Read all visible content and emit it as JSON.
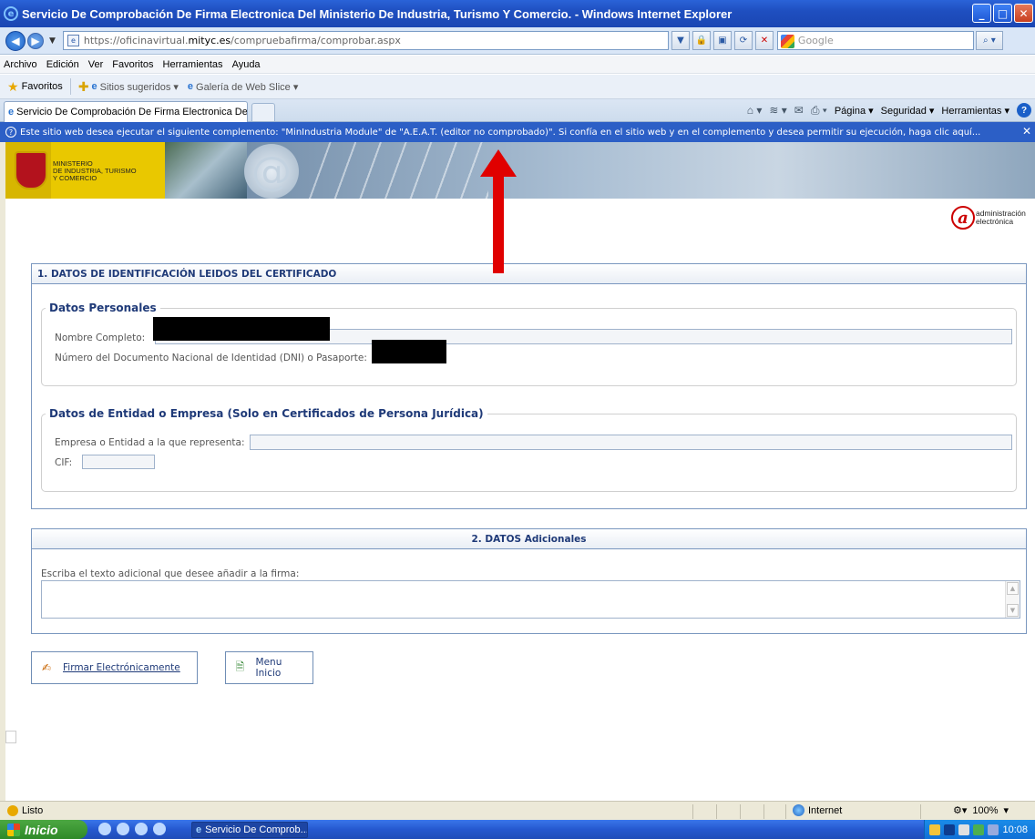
{
  "window": {
    "title": "Servicio De Comprobación De Firma Electronica Del Ministerio De Industria, Turismo Y Comercio. - Windows Internet Explorer",
    "controls": [
      "_",
      "□",
      "✕"
    ]
  },
  "address_bar": {
    "url_scheme_host": "https://oficinavirtual.",
    "url_domain": "mityc.es",
    "url_path": "/compruebafirma/comprobar.aspx",
    "search_placeholder": "Google"
  },
  "menu": [
    "Archivo",
    "Edición",
    "Ver",
    "Favoritos",
    "Herramientas",
    "Ayuda"
  ],
  "favorites_bar": {
    "label": "Favoritos",
    "items": [
      "Sitios sugeridos ▾",
      "Galería de Web Slice ▾"
    ]
  },
  "tab": {
    "label": "Servicio De Comprobación De Firma Electronica Del Mi..."
  },
  "command_bar": [
    "Página ▾",
    "Seguridad ▾",
    "Herramientas ▾"
  ],
  "info_bar": {
    "text": "Este sitio web desea ejecutar el siguiente complemento: \"MinIndustria Module\" de \"A.E.A.T. (editor no comprobado)\". Si confía en el sitio web y en el complemento y desea permitir su ejecución, haga clic aquí..."
  },
  "banner": {
    "ministry_line1": "MINISTERIO",
    "ministry_line2": "DE INDUSTRIA, TURISMO",
    "ministry_line3": "Y COMERCIO"
  },
  "ae_logo": {
    "letter": "a",
    "line1": "administración",
    "line2": "electrónica"
  },
  "section1": {
    "title": "1. DATOS DE IDENTIFICACIÓN LEIDOS DEL CERTIFICADO",
    "personal": {
      "legend": "Datos Personales",
      "name_label": "Nombre Completo:",
      "dni_label": "Número del Documento Nacional de Identidad (DNI) o Pasaporte:"
    },
    "company": {
      "legend": "Datos de Entidad o Empresa (Solo en Certificados de Persona Jurídica)",
      "company_label": "Empresa o Entidad a la que representa:",
      "cif_label": "CIF:"
    }
  },
  "section2": {
    "title": "2. DATOS Adicionales",
    "text_label": "Escriba el texto adicional que desee añadir a la firma:"
  },
  "buttons": {
    "sign": "Firmar Electrónicamente",
    "menu": "Menu Inicio"
  },
  "status_bar": {
    "status": "Listo",
    "zone": "Internet",
    "zoom": "100%"
  },
  "taskbar": {
    "start": "Inicio",
    "task": "Servicio De Comprob...",
    "clock": "10:08"
  },
  "colors": {
    "title_bar": "#1f4fc0",
    "info_bar": "#2c5fc6",
    "panel_border": "#7a97bf",
    "heading_text": "#1f3a78",
    "arrow": "#e00000"
  }
}
